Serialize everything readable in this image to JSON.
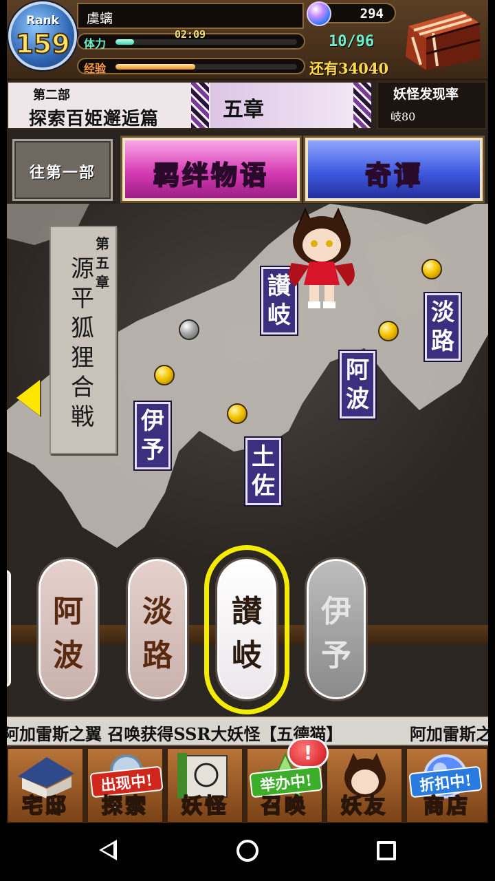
{
  "header": {
    "rank_label": "Rank",
    "rank_value": "159",
    "player_name": "虞螭",
    "stamina_label": "体力",
    "stamina_timer": "02:09",
    "stamina_value": "10/96",
    "stamina_fraction": 0.104,
    "exp_label": "经验",
    "exp_fraction": 0.44,
    "exp_remaining": "还有34040",
    "gem_count": "294"
  },
  "banner": {
    "part_label": "第二部",
    "part_title": "探索百姫邂逅篇",
    "chapter_name": "五章",
    "discover_title": "妖怪发现率",
    "discover_value": "岐80"
  },
  "buttons": {
    "part1": "往第一部",
    "bond_story": "羁绊物语",
    "strange_tale": "奇谭"
  },
  "map": {
    "chapter_sub": "第五章",
    "chapter_title": "源平狐狸合戦",
    "regions": [
      "讃岐",
      "淡路",
      "阿波",
      "伊予",
      "土佐"
    ]
  },
  "selector": {
    "items": [
      {
        "label": "阿波",
        "state": "normal"
      },
      {
        "label": "淡路",
        "state": "normal"
      },
      {
        "label": "讃岐",
        "state": "selected"
      },
      {
        "label": "伊予",
        "state": "locked"
      }
    ]
  },
  "ticker": {
    "text": "阿加雷斯之翼 召唤获得SSR大妖怪【五德猫】",
    "text_repeat": "阿加雷斯之"
  },
  "bottom_nav": {
    "alert": "!",
    "items": [
      {
        "label": "宅邸",
        "badge": ""
      },
      {
        "label": "探索",
        "badge": "出现中!"
      },
      {
        "label": "妖怪",
        "badge": ""
      },
      {
        "label": "召唤",
        "badge": "举办中!"
      },
      {
        "label": "妖友",
        "badge": ""
      },
      {
        "label": "商店",
        "badge": "折扣中!"
      }
    ]
  },
  "colors": {
    "bond_button": "#d63cb4",
    "tale_button": "#3f5ae0",
    "region_tag": "#3d2f80",
    "selection_ring": "#f4ec00",
    "marker_gold": "#f5c400"
  },
  "icons": [
    "gem-icon",
    "treasure-chest-icon",
    "arrow-left-icon",
    "map-marker-icon",
    "fox-girl-avatar",
    "back-icon",
    "home-icon",
    "recent-apps-icon"
  ]
}
